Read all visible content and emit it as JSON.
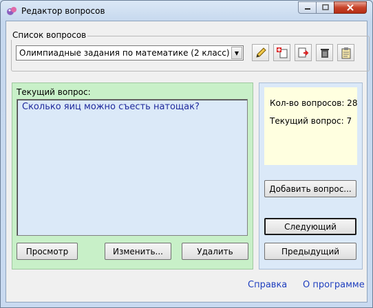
{
  "window": {
    "title": "Редактор вопросов"
  },
  "questions_list": {
    "group_label": "Список вопросов",
    "selected": "Олимпиадные задания по математике (2 класс)",
    "tools": [
      "pencil-icon",
      "add-document-icon",
      "export-document-icon",
      "trash-icon",
      "clipboard-icon"
    ]
  },
  "current": {
    "label": "Текущий вопрос:",
    "question_text": "Сколько яиц можно съесть натощак?",
    "buttons": {
      "preview": "Просмотр",
      "edit": "Изменить...",
      "delete": "Удалить"
    }
  },
  "stats": {
    "count_line": "Кол-во вопросов: 28",
    "current_line": "Текущий вопрос: 7"
  },
  "nav": {
    "add": "Добавить вопрос...",
    "next": "Следующий",
    "prev": "Предыдущий"
  },
  "footer": {
    "help": "Справка",
    "about": "О программе"
  },
  "colors": {
    "green_panel": "#c8f0c8",
    "blue_panel": "#dbe9f8",
    "stats_bg": "#ffffe0",
    "question_text": "#1f2a9c",
    "link": "#1f3fbf"
  }
}
